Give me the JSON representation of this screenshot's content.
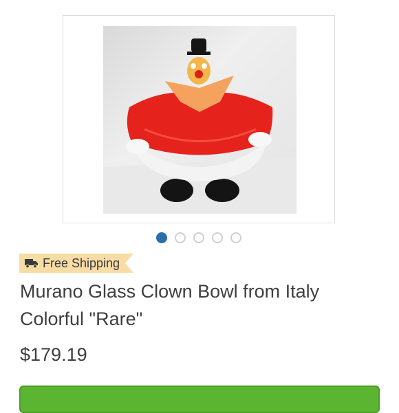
{
  "product": {
    "image": {
      "subject": "murano-glass-clown-bowl",
      "colors": {
        "bowl_red": "#e6221c",
        "bowl_white": "#f3f3f3",
        "feet_black": "#151515",
        "collar_orange": "#f6a25f",
        "hat_black": "#1a1a1a"
      }
    },
    "carousel": {
      "count": 5,
      "active_index": 0
    },
    "shipping_badge": {
      "icon": "truck-icon",
      "label": "Free Shipping",
      "color": "#f8dca6"
    },
    "title": "Murano Glass Clown Bowl from Italy Colorful \"Rare\"",
    "price": "$179.19",
    "buy_button": {
      "color": "#5cb531"
    }
  }
}
